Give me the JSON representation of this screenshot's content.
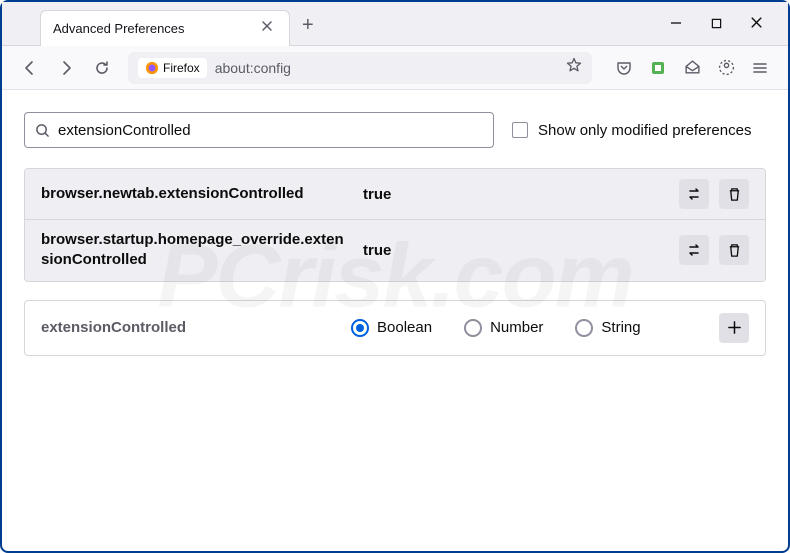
{
  "tab": {
    "title": "Advanced Preferences"
  },
  "url": {
    "identity": "Firefox",
    "address": "about:config"
  },
  "search": {
    "value": "extensionControlled",
    "filter_label": "Show only modified preferences"
  },
  "prefs": [
    {
      "name": "browser.newtab.extensionControlled",
      "value": "true"
    },
    {
      "name": "browser.startup.homepage_override.extensionControlled",
      "value": "true"
    }
  ],
  "new_pref": {
    "name": "extensionControlled",
    "types": {
      "boolean": "Boolean",
      "number": "Number",
      "string": "String"
    }
  },
  "watermark": "PCrisk.com"
}
